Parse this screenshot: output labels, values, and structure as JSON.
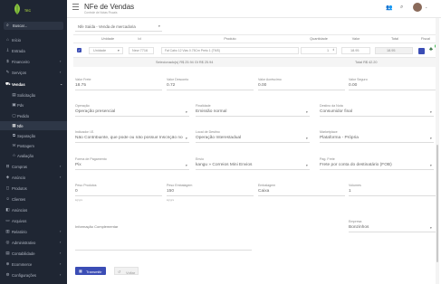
{
  "sidebar": {
    "logo_text": "TEC",
    "search_placeholder": "Buscar...",
    "items": [
      {
        "label": "Início",
        "icon": "home-icon"
      },
      {
        "label": "Entrada",
        "icon": "entry-icon"
      },
      {
        "label": "Financeiro",
        "icon": "finance-icon"
      },
      {
        "label": "Serviços",
        "icon": "services-icon"
      },
      {
        "label": "Vendas",
        "icon": "cart-icon"
      }
    ],
    "sub_items": [
      {
        "label": "Solicitação"
      },
      {
        "label": "Pdv"
      },
      {
        "label": "Pedido"
      },
      {
        "label": "Nfe"
      },
      {
        "label": "Separação"
      },
      {
        "label": "Postagem"
      },
      {
        "label": "Avaliação"
      }
    ],
    "items_after": [
      {
        "label": "Compras",
        "icon": "purchase-icon"
      },
      {
        "label": "Anúncio",
        "icon": "announce-icon"
      },
      {
        "label": "Produtos",
        "icon": "products-icon"
      },
      {
        "label": "Clientes",
        "icon": "clients-icon"
      },
      {
        "label": "Anúncios",
        "icon": "ads-icon"
      },
      {
        "label": "Arquivos",
        "icon": "files-icon"
      },
      {
        "label": "Relatório",
        "icon": "report-icon"
      },
      {
        "label": "Administrativo",
        "icon": "admin-icon"
      },
      {
        "label": "Contabilidade",
        "icon": "accounting-icon"
      },
      {
        "label": "Ecommerce",
        "icon": "ecommerce-icon"
      },
      {
        "label": "Configurações",
        "icon": "settings-icon"
      }
    ]
  },
  "topbar": {
    "title": "NFe de Vendas",
    "subtitle": "Controle de Notas Fiscais"
  },
  "form": {
    "nature_select": "Nfe Saída - Venda de mercadoria",
    "table": {
      "headers": [
        "Unidade",
        "Id",
        "Produto",
        "Quantidade",
        "Valor",
        "Total",
        "Fiscal"
      ],
      "row": {
        "unit": "Unidade",
        "id": "New 7716",
        "product": "Fal Cabo 12 Vias 0.75Cm Preto 1 (TMS)",
        "quantity": "1",
        "value": "18.95",
        "total": "18.95"
      },
      "total_selected": "Selecionado(s) R$ 25.94 Gt R$ 25.94",
      "total_nf": "Total R$ 42.20"
    },
    "valor_frete": {
      "label": "Valor Frete",
      "value": "18.75"
    },
    "valor_desconto": {
      "label": "Valor Desconto",
      "value": "0.72"
    },
    "valor_acrescimo": {
      "label": "Valor Acréscimo",
      "value": "0.00"
    },
    "valor_seguro": {
      "label": "Valor Seguro",
      "value": "0.00"
    },
    "operacao": {
      "label": "Operação",
      "value": "Operação presencial"
    },
    "finalidade": {
      "label": "Finalidade",
      "value": "Emissão normal"
    },
    "destino": {
      "label": "Destino da Nota",
      "value": "Consumidor final"
    },
    "indicador": {
      "label": "Indicador I.E.",
      "value": "Não Contribuinte, que pode ou não possuir Inscrição no"
    },
    "local_destino": {
      "label": "Local de Destino",
      "value": "Operação Interestadual"
    },
    "marketplace": {
      "label": "Marketplace",
      "value": "Plataforma - Própria"
    },
    "forma_pagamento": {
      "label": "Forma de Pagamento",
      "value": "Pix"
    },
    "envio": {
      "label": "Envio",
      "value": "kangu » Correios Mini Envios"
    },
    "pag_frete": {
      "label": "Pag. Frete",
      "value": "Frete por conta do destinatário (FOB)"
    },
    "peso_produtos": {
      "label": "Peso Produtos",
      "value": "0",
      "hint": "kg/grs"
    },
    "peso_embalagem": {
      "label": "Peso Embalagem",
      "value": "150",
      "hint": "kg/grs"
    },
    "embalagem": {
      "label": "Embalagem",
      "value": "Caixa"
    },
    "volumes": {
      "label": "Volumes",
      "value": "1"
    },
    "info_complementar": {
      "label": "Informação Complementar",
      "value": ""
    },
    "empresa": {
      "label": "Empresa",
      "value": "Bonzinhos"
    },
    "transmit_label": "Transmitir",
    "cancel_label": "Voltar"
  },
  "colors": {
    "sidebar_bg": "#1f2633",
    "primary": "#3b4db5",
    "logo_green": "#9fc43f"
  }
}
